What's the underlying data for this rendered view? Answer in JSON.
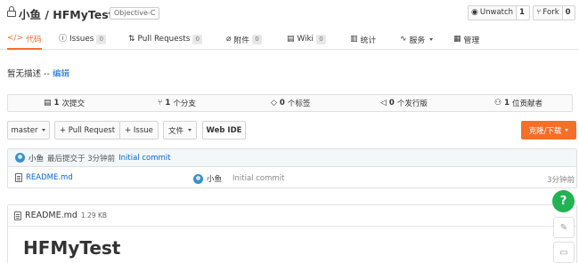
{
  "repo": {
    "title": "小鱼 / HFMyTest",
    "language": "Objective-C"
  },
  "header_actions": {
    "watch_label": "Unwatch",
    "watch_count": "1",
    "fork_label": "Fork",
    "fork_count": "0"
  },
  "tabs": [
    {
      "label": "代码",
      "count": null,
      "active": true
    },
    {
      "label": "Issues",
      "count": "0"
    },
    {
      "label": "Pull Requests",
      "count": "0"
    },
    {
      "label": "附件",
      "count": "0"
    },
    {
      "label": "Wiki",
      "count": "0"
    },
    {
      "label": "统计",
      "count": null
    },
    {
      "label": "服务",
      "count": null
    },
    {
      "label": "管理",
      "count": null
    }
  ],
  "description": {
    "text": "暂无描述 --",
    "edit_link": "编辑"
  },
  "stats": [
    {
      "num": "1",
      "label": "次提交"
    },
    {
      "num": "1",
      "label": "个分支"
    },
    {
      "num": "0",
      "label": "个标签"
    },
    {
      "num": "0",
      "label": "个发行版"
    },
    {
      "num": "1",
      "label": "位贡献者"
    }
  ],
  "toolbar": {
    "branch": "master",
    "pull_request": "+ Pull Request",
    "issue": "+ Issue",
    "file": "文件",
    "web_ide": "Web IDE",
    "clone": "克隆/下载"
  },
  "last_commit": {
    "author": "小鱼",
    "meta": "最后提交于 3分钟前",
    "message": "Initial commit"
  },
  "files": [
    {
      "name": "README.md",
      "author": "小鱼",
      "message": "Initial commit",
      "time": "3分钟前"
    }
  ],
  "readme": {
    "filename": "README.md",
    "size": "1.29 KB",
    "heading": "HFMyTest"
  },
  "floating": {
    "help": "?"
  },
  "colors": {
    "accent": "#f56f2a",
    "link": "#0366d6",
    "help": "#21b351"
  }
}
